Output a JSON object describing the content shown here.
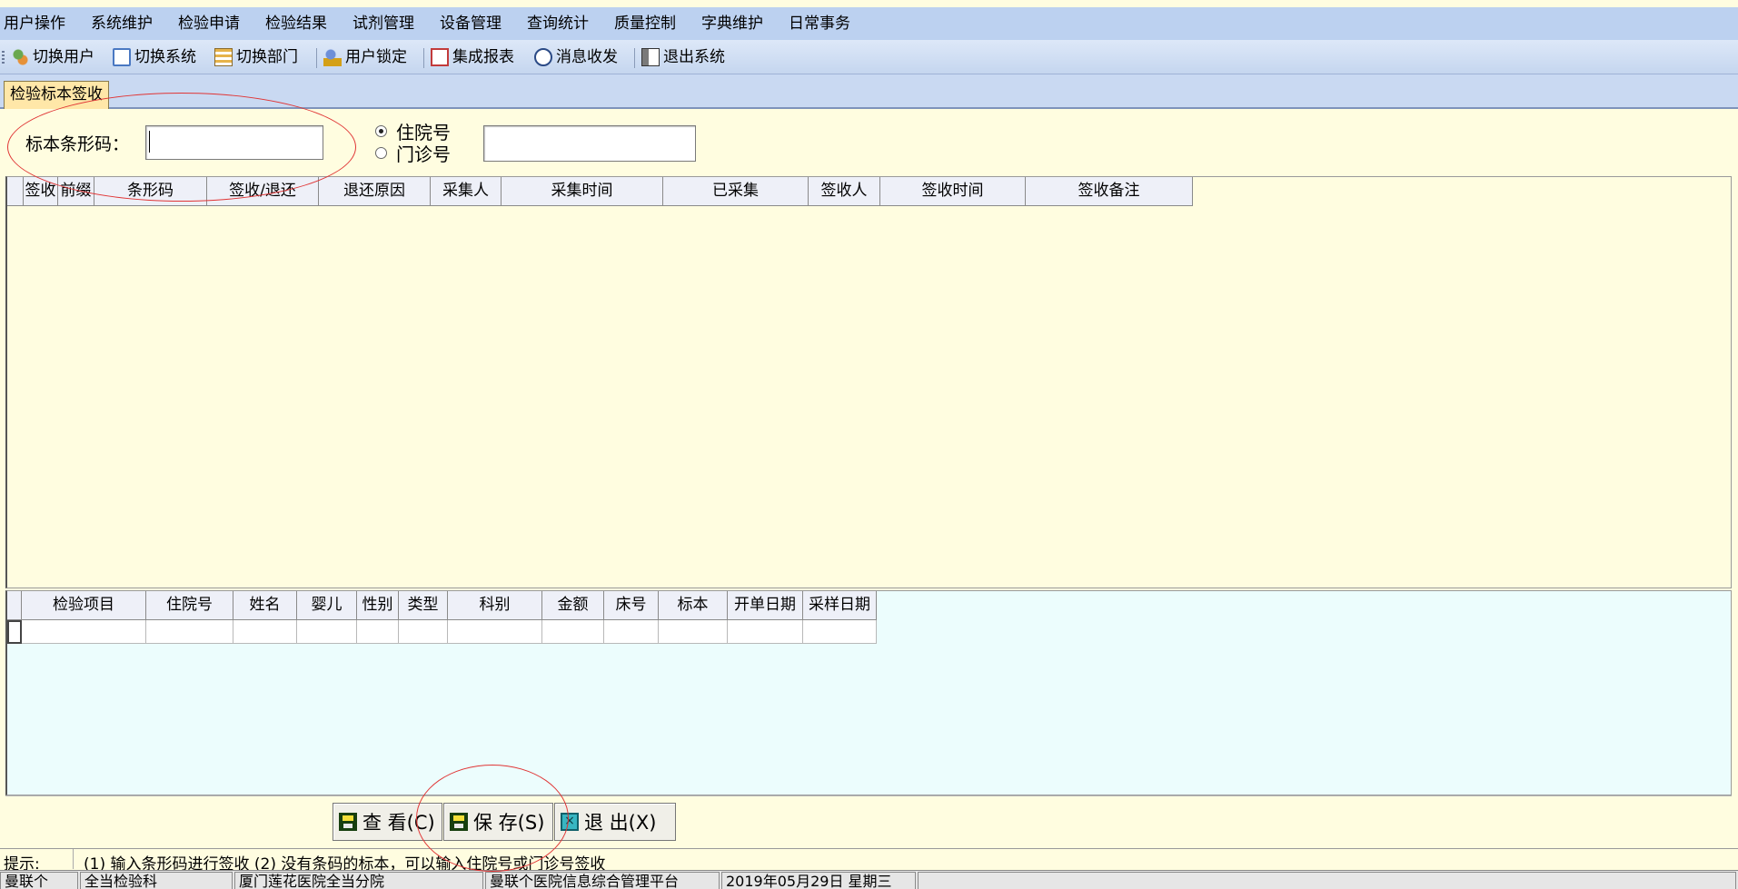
{
  "menus": [
    "用户操作",
    "系统维护",
    "检验申请",
    "检验结果",
    "试剂管理",
    "设备管理",
    "查询统计",
    "质量控制",
    "字典维护",
    "日常事务"
  ],
  "toolbar": [
    {
      "label": "切换用户",
      "icon": "switch-user-icon"
    },
    {
      "label": "切换系统",
      "icon": "switch-system-icon"
    },
    {
      "label": "切换部门",
      "icon": "switch-department-icon"
    },
    {
      "label": "用户锁定",
      "icon": "user-lock-icon"
    },
    {
      "label": "集成报表",
      "icon": "report-icon"
    },
    {
      "label": "消息收发",
      "icon": "info-icon"
    },
    {
      "label": "退出系统",
      "icon": "exit-door-icon"
    }
  ],
  "tab": {
    "label": "检验标本签收"
  },
  "filter": {
    "barcode_label": "标本条形码：",
    "barcode_value": "",
    "radio_inpatient": "住院号",
    "radio_outpatient": "门诊号",
    "selected": "住院号",
    "number_value": ""
  },
  "grid1": {
    "columns": [
      "签收",
      "前缀",
      "条形码",
      "签收/退还",
      "退还原因",
      "采集人",
      "采集时间",
      "已采集",
      "签收人",
      "签收时间",
      "签收备注"
    ],
    "rows": []
  },
  "grid2": {
    "columns": [
      "检验项目",
      "住院号",
      "姓名",
      "婴儿",
      "性别",
      "类型",
      "科别",
      "金额",
      "床号",
      "标本",
      "开单日期",
      "采样日期"
    ],
    "rows": [
      [
        "",
        "",
        "",
        "",
        "",
        "",
        "",
        "",
        "",
        "",
        "",
        ""
      ]
    ]
  },
  "buttons": {
    "view": "查 看(C)",
    "save": "保 存(S)",
    "exit": "退 出(X)"
  },
  "hint": {
    "label": "提示:",
    "text": "(1) 输入条形码进行签收 (2) 没有条码的标本，可以输入住院号或门诊号签收"
  },
  "status": [
    "曼联个",
    "全当检验科",
    "厦门莲花医院全当分院",
    "曼联个医院信息综合管理平台",
    "2019年05月29日 星期三",
    ""
  ],
  "colors": {
    "menu_bg": "#bcd1f0",
    "panel_bg": "#fffde0",
    "detail_bg": "#ecfdfd",
    "annotation": "#e03535"
  }
}
